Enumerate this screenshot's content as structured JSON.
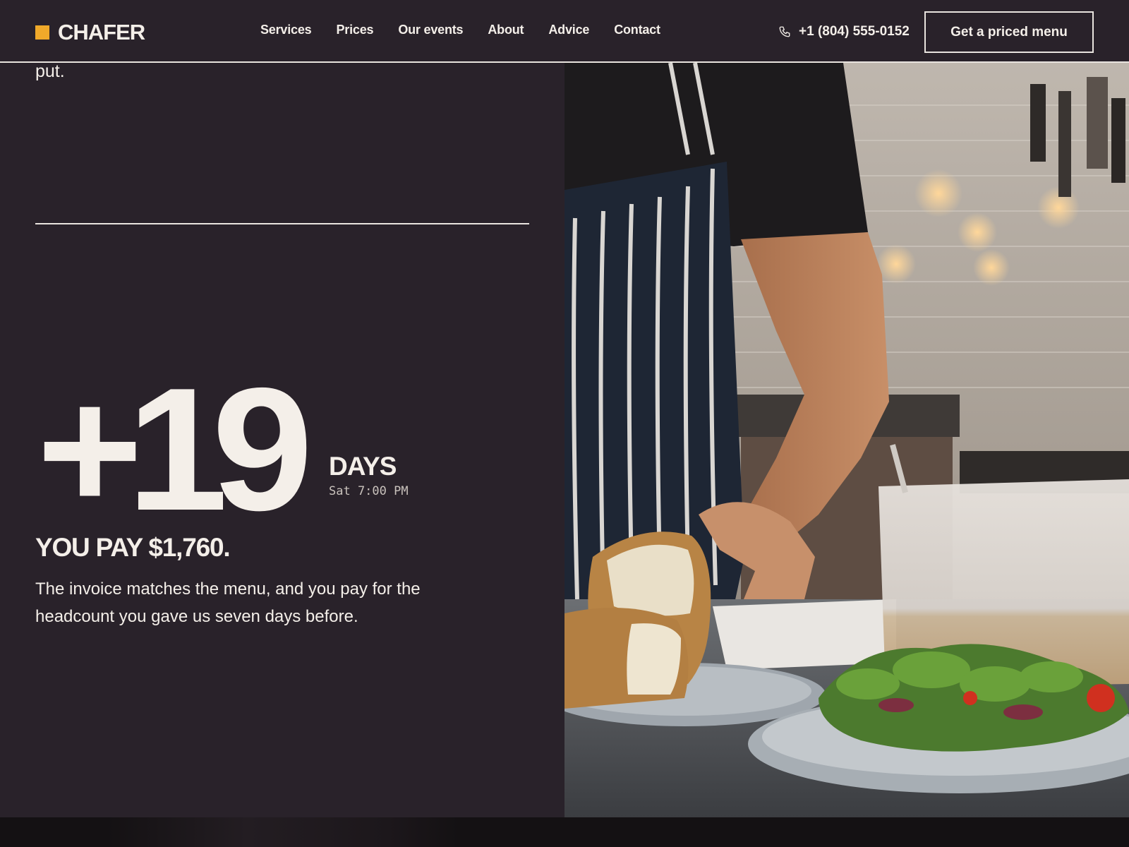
{
  "brand": {
    "name": "CHAFER",
    "accent_color": "#f0a92a"
  },
  "nav": {
    "items": [
      {
        "label": "Services"
      },
      {
        "label": "Prices"
      },
      {
        "label": "Our events"
      },
      {
        "label": "About"
      },
      {
        "label": "Advice"
      },
      {
        "label": "Contact"
      }
    ]
  },
  "header": {
    "phone_icon": "phone-icon",
    "phone": "+1 (804) 555-0152",
    "cta_label": "Get a priced menu"
  },
  "main": {
    "cut_text": "put.",
    "stat_value": "+19",
    "stat_unit": "DAYS",
    "stat_sub": "Sat 7:00 PM",
    "pay_heading": "YOU PAY $1,760.",
    "description": "The invoice matches the menu, and you pay for the headcount you gave us seven days before."
  },
  "colors": {
    "background": "#29222a",
    "text": "#f4efe9",
    "border": "#e9e4df"
  }
}
